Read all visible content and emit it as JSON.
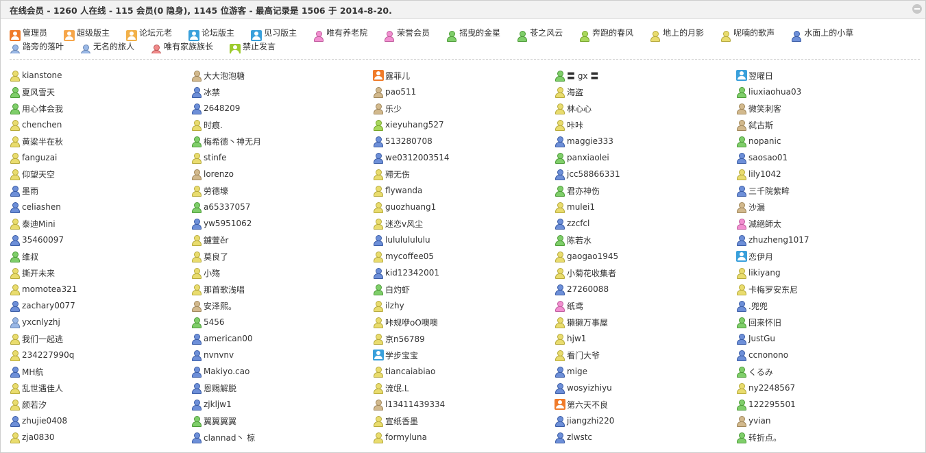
{
  "header": {
    "title": "在线会员 - 1260 人在线 - 115 会员(0 隐身), 1145 位游客 - 最高记录是 1506 于 2014-8-20."
  },
  "colors": {
    "admin": "#f07b2a",
    "super_mod": "#f6a64a",
    "elder": "#f2b14a",
    "mod": "#3aa0db",
    "trainee_mod": "#3aa0db",
    "grey": "#d2b98d",
    "pink": "#f28fd0",
    "green": "#7fce6a",
    "lime": "#a9d85c",
    "yellow": "#e9dc6e",
    "blue": "#6d8fd8",
    "lightblue": "#9ab8e6",
    "red": "#f08a8a",
    "banned": "#9dcb2e"
  },
  "legend": [
    {
      "label": "管理员",
      "icon": "admin-badge-icon",
      "style": "badge",
      "color": "#f07b2a"
    },
    {
      "label": "超级版主",
      "icon": "super-moderator-badge-icon",
      "style": "badge",
      "color": "#f6a64a"
    },
    {
      "label": "论坛元老",
      "icon": "forum-elder-badge-icon",
      "style": "badge",
      "color": "#f2b14a"
    },
    {
      "label": "论坛版主",
      "icon": "forum-moderator-badge-icon",
      "style": "badge",
      "color": "#3aa0db"
    },
    {
      "label": "见习版主",
      "icon": "trainee-moderator-badge-icon",
      "style": "badge",
      "color": "#3aa0db"
    },
    {
      "label": "唯有养老院",
      "icon": "user-icon",
      "style": "person",
      "color": "#f28fd0"
    },
    {
      "label": "荣誉会员",
      "icon": "user-icon",
      "style": "person",
      "color": "#f28fd0"
    },
    {
      "label": "摇曳的金星",
      "icon": "user-icon",
      "style": "person",
      "color": "#7fce6a"
    },
    {
      "label": "苍之风云",
      "icon": "user-icon",
      "style": "person",
      "color": "#7fce6a"
    },
    {
      "label": "奔跑的春风",
      "icon": "user-icon",
      "style": "person",
      "color": "#a9d85c"
    },
    {
      "label": "地上的月影",
      "icon": "user-icon",
      "style": "person",
      "color": "#e9dc6e"
    },
    {
      "label": "呢喃的歌声",
      "icon": "user-icon",
      "style": "person",
      "color": "#e9dc6e"
    },
    {
      "label": "水面上的小草",
      "icon": "user-icon",
      "style": "person",
      "color": "#6d8fd8"
    },
    {
      "label": "路旁的落叶",
      "icon": "user-icon",
      "style": "person",
      "color": "#9ab8e6"
    },
    {
      "label": "无名的旅人",
      "icon": "user-icon",
      "style": "person",
      "color": "#9ab8e6"
    },
    {
      "label": "唯有家族族长",
      "icon": "user-icon",
      "style": "person",
      "color": "#f08a8a"
    },
    {
      "label": "禁止发言",
      "icon": "banned-badge-icon",
      "style": "badge",
      "color": "#9dcb2e"
    }
  ],
  "members": [
    {
      "name": "kianstone",
      "c": "yellow"
    },
    {
      "name": "大大泡泡糖",
      "c": "grey"
    },
    {
      "name": "露菲儿",
      "c": "admin"
    },
    {
      "name": "〓 gx 〓",
      "c": "green"
    },
    {
      "name": "翌曜日",
      "c": "mod"
    },
    {
      "name": "夏风雪天",
      "c": "green"
    },
    {
      "name": "冰禁",
      "c": "blue"
    },
    {
      "name": "pao511",
      "c": "grey"
    },
    {
      "name": "海盗",
      "c": "yellow"
    },
    {
      "name": "liuxiaohua03",
      "c": "green"
    },
    {
      "name": "用心体会我",
      "c": "green"
    },
    {
      "name": "2648209",
      "c": "blue"
    },
    {
      "name": "乐少",
      "c": "grey"
    },
    {
      "name": "林心心",
      "c": "yellow"
    },
    {
      "name": "微笑刺客",
      "c": "grey"
    },
    {
      "name": "chenchen",
      "c": "yellow"
    },
    {
      "name": "时痕.",
      "c": "yellow"
    },
    {
      "name": "xieyuhang527",
      "c": "lime"
    },
    {
      "name": "咔咔",
      "c": "yellow"
    },
    {
      "name": "弑古斯",
      "c": "grey"
    },
    {
      "name": "黄粱半在秋",
      "c": "yellow"
    },
    {
      "name": "梅希德丶神无月",
      "c": "green"
    },
    {
      "name": "513280708",
      "c": "blue"
    },
    {
      "name": "maggie333",
      "c": "blue"
    },
    {
      "name": "nopanic",
      "c": "green"
    },
    {
      "name": "fanguzai",
      "c": "yellow"
    },
    {
      "name": "stinfe",
      "c": "yellow"
    },
    {
      "name": "we0312003514",
      "c": "blue"
    },
    {
      "name": "panxiaolei",
      "c": "green"
    },
    {
      "name": "saosao01",
      "c": "blue"
    },
    {
      "name": "仰望天空",
      "c": "yellow"
    },
    {
      "name": "lorenzo",
      "c": "grey"
    },
    {
      "name": "殢无伤",
      "c": "yellow"
    },
    {
      "name": "jcc58866331",
      "c": "blue"
    },
    {
      "name": "lily1042",
      "c": "yellow"
    },
    {
      "name": "墨雨",
      "c": "blue"
    },
    {
      "name": "劳德壕",
      "c": "yellow"
    },
    {
      "name": "flywanda",
      "c": "yellow"
    },
    {
      "name": "君亦神伤",
      "c": "green"
    },
    {
      "name": "三千院紫眸",
      "c": "blue"
    },
    {
      "name": "celiashen",
      "c": "blue"
    },
    {
      "name": "a65337057",
      "c": "green"
    },
    {
      "name": "guozhuang1",
      "c": "yellow"
    },
    {
      "name": "mulei1",
      "c": "yellow"
    },
    {
      "name": "沙漏",
      "c": "grey"
    },
    {
      "name": "泰迪Mini",
      "c": "yellow"
    },
    {
      "name": "yw5951062",
      "c": "blue"
    },
    {
      "name": "迷恋v风尘",
      "c": "yellow"
    },
    {
      "name": "zzcfcl",
      "c": "blue"
    },
    {
      "name": "滅絕師太",
      "c": "pink"
    },
    {
      "name": "35460097",
      "c": "blue"
    },
    {
      "name": "鑢萱ěr",
      "c": "yellow"
    },
    {
      "name": "lulululululu",
      "c": "blue"
    },
    {
      "name": "陈若水",
      "c": "green"
    },
    {
      "name": "zhuzheng1017",
      "c": "blue"
    },
    {
      "name": "维叔",
      "c": "green"
    },
    {
      "name": "莫良了",
      "c": "yellow"
    },
    {
      "name": "mycoffee05",
      "c": "yellow"
    },
    {
      "name": "gaogao1945",
      "c": "yellow"
    },
    {
      "name": "恋伊月",
      "c": "mod"
    },
    {
      "name": "撕开未来",
      "c": "yellow"
    },
    {
      "name": "小殇",
      "c": "yellow"
    },
    {
      "name": "kid12342001",
      "c": "blue"
    },
    {
      "name": "小菊花收集者",
      "c": "yellow"
    },
    {
      "name": "likiyang",
      "c": "yellow"
    },
    {
      "name": "momotea321",
      "c": "yellow"
    },
    {
      "name": "那首歌浅唱",
      "c": "yellow"
    },
    {
      "name": "白灼虾",
      "c": "green"
    },
    {
      "name": "27260088",
      "c": "blue"
    },
    {
      "name": "卡梅罗安东尼",
      "c": "yellow"
    },
    {
      "name": "zachary0077",
      "c": "blue"
    },
    {
      "name": "安泽熙。",
      "c": "grey"
    },
    {
      "name": "ilzhy",
      "c": "yellow"
    },
    {
      "name": "纸鸢",
      "c": "pink"
    },
    {
      "name": ".兜兜",
      "c": "blue"
    },
    {
      "name": "yxcnlyzhj",
      "c": "lightblue"
    },
    {
      "name": "5456",
      "c": "green"
    },
    {
      "name": "咔规咿oO噢噢",
      "c": "yellow"
    },
    {
      "name": "獭獭万事屋",
      "c": "yellow"
    },
    {
      "name": "回来怀旧",
      "c": "green"
    },
    {
      "name": "我们一起逃",
      "c": "yellow"
    },
    {
      "name": "american00",
      "c": "blue"
    },
    {
      "name": "京n56789",
      "c": "yellow"
    },
    {
      "name": "hjw1",
      "c": "yellow"
    },
    {
      "name": "JustGu",
      "c": "blue"
    },
    {
      "name": "234227990q",
      "c": "yellow"
    },
    {
      "name": "nvnvnv",
      "c": "blue"
    },
    {
      "name": "学步宝宝",
      "c": "mod"
    },
    {
      "name": "看门大爷",
      "c": "yellow"
    },
    {
      "name": "ccnonono",
      "c": "blue"
    },
    {
      "name": "MH航",
      "c": "blue"
    },
    {
      "name": "Makiyo.cao",
      "c": "blue"
    },
    {
      "name": "tiancaiabiao",
      "c": "yellow"
    },
    {
      "name": "mige",
      "c": "blue"
    },
    {
      "name": "くるみ",
      "c": "green"
    },
    {
      "name": "乱世遇佳人",
      "c": "yellow"
    },
    {
      "name": "恩赐解脱",
      "c": "blue"
    },
    {
      "name": "流氓.L",
      "c": "yellow"
    },
    {
      "name": "wosyizhiyu",
      "c": "blue"
    },
    {
      "name": "ny2248567",
      "c": "yellow"
    },
    {
      "name": "颜若汐",
      "c": "yellow"
    },
    {
      "name": "zjkljw1",
      "c": "blue"
    },
    {
      "name": "l13411439334",
      "c": "grey"
    },
    {
      "name": "第六天不良",
      "c": "admin"
    },
    {
      "name": "122295501",
      "c": "green"
    },
    {
      "name": "zhujie0408",
      "c": "blue"
    },
    {
      "name": "翼翼翼翼",
      "c": "green"
    },
    {
      "name": "宣纸香墨",
      "c": "yellow"
    },
    {
      "name": "jiangzhi220",
      "c": "blue"
    },
    {
      "name": "yvian",
      "c": "grey"
    },
    {
      "name": "zja0830",
      "c": "yellow"
    },
    {
      "name": "clannad丶 椋",
      "c": "blue"
    },
    {
      "name": "formyluna",
      "c": "yellow"
    },
    {
      "name": "zlwstc",
      "c": "blue"
    },
    {
      "name": "转折点。",
      "c": "green"
    }
  ]
}
